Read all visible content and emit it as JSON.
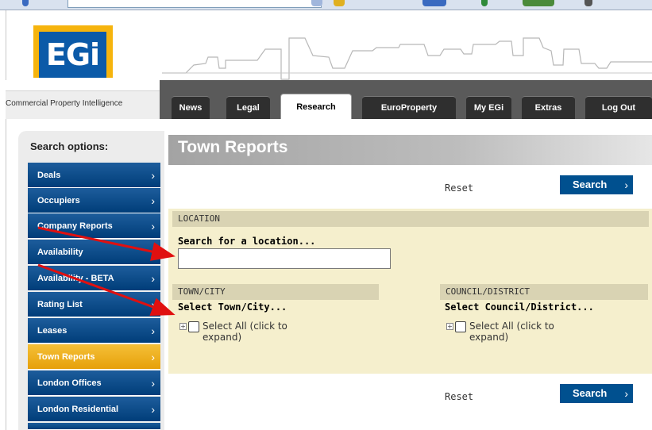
{
  "header": {
    "logo_text": "EGi",
    "tagline": "Commercial Property Intelligence"
  },
  "nav": {
    "tabs": [
      {
        "label": "News"
      },
      {
        "label": "Legal"
      },
      {
        "label": "Research"
      },
      {
        "label": "EuroProperty"
      },
      {
        "label": "My EGi"
      },
      {
        "label": "Extras"
      },
      {
        "label": "Log Out"
      }
    ],
    "active_tab": "Research"
  },
  "sidebar": {
    "title": "Search options:",
    "items": [
      {
        "label": "Deals"
      },
      {
        "label": "Occupiers"
      },
      {
        "label": "Company Reports"
      },
      {
        "label": "Availability"
      },
      {
        "label": "Availability - BETA"
      },
      {
        "label": "Rating List"
      },
      {
        "label": "Leases"
      },
      {
        "label": "Town Reports"
      },
      {
        "label": "London Offices"
      },
      {
        "label": "London Residential"
      }
    ],
    "active_item": "Town Reports"
  },
  "main": {
    "title": "Town Reports",
    "reset_label": "Reset",
    "search_label": "Search",
    "location": {
      "header": "LOCATION",
      "label": "Search for a location...",
      "value": ""
    },
    "town_city": {
      "header": "TOWN/CITY",
      "label": "Select Town/City...",
      "tree_item": "Select All (click to expand)"
    },
    "council_district": {
      "header": "COUNCIL/DISTRICT",
      "label": "Select Council/District...",
      "tree_item": "Select All (click to expand)"
    }
  },
  "colors": {
    "nav_blue": "#00508f",
    "active_orange": "#f0b21e",
    "form_bg": "#f5efcd",
    "annotation_red": "#e01010"
  }
}
